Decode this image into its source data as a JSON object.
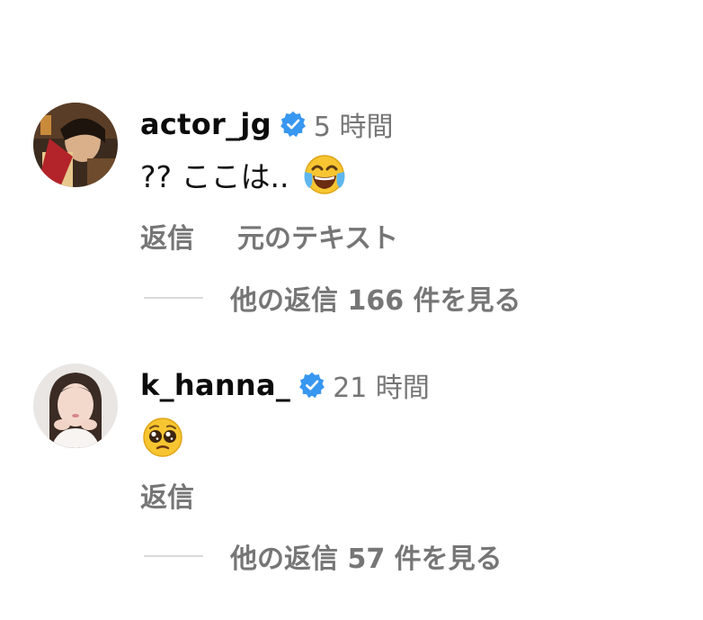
{
  "comments": [
    {
      "username": "actor_jg",
      "timestamp": "5 時間",
      "text": "?? ここは..",
      "emoji": "face-with-tears-of-joy",
      "actions": {
        "reply": "返信",
        "see_original": "元のテキスト"
      },
      "view_replies": "他の返信 166 件を見る"
    },
    {
      "username": "k_hanna_",
      "timestamp": "21 時間",
      "text": "",
      "emoji": "pleading-face",
      "actions": {
        "reply": "返信"
      },
      "view_replies": "他の返信 57 件を見る"
    }
  ],
  "colors": {
    "verified_badge": "#3897f0",
    "secondary_text": "#767676",
    "divider": "#dbdbdb"
  }
}
